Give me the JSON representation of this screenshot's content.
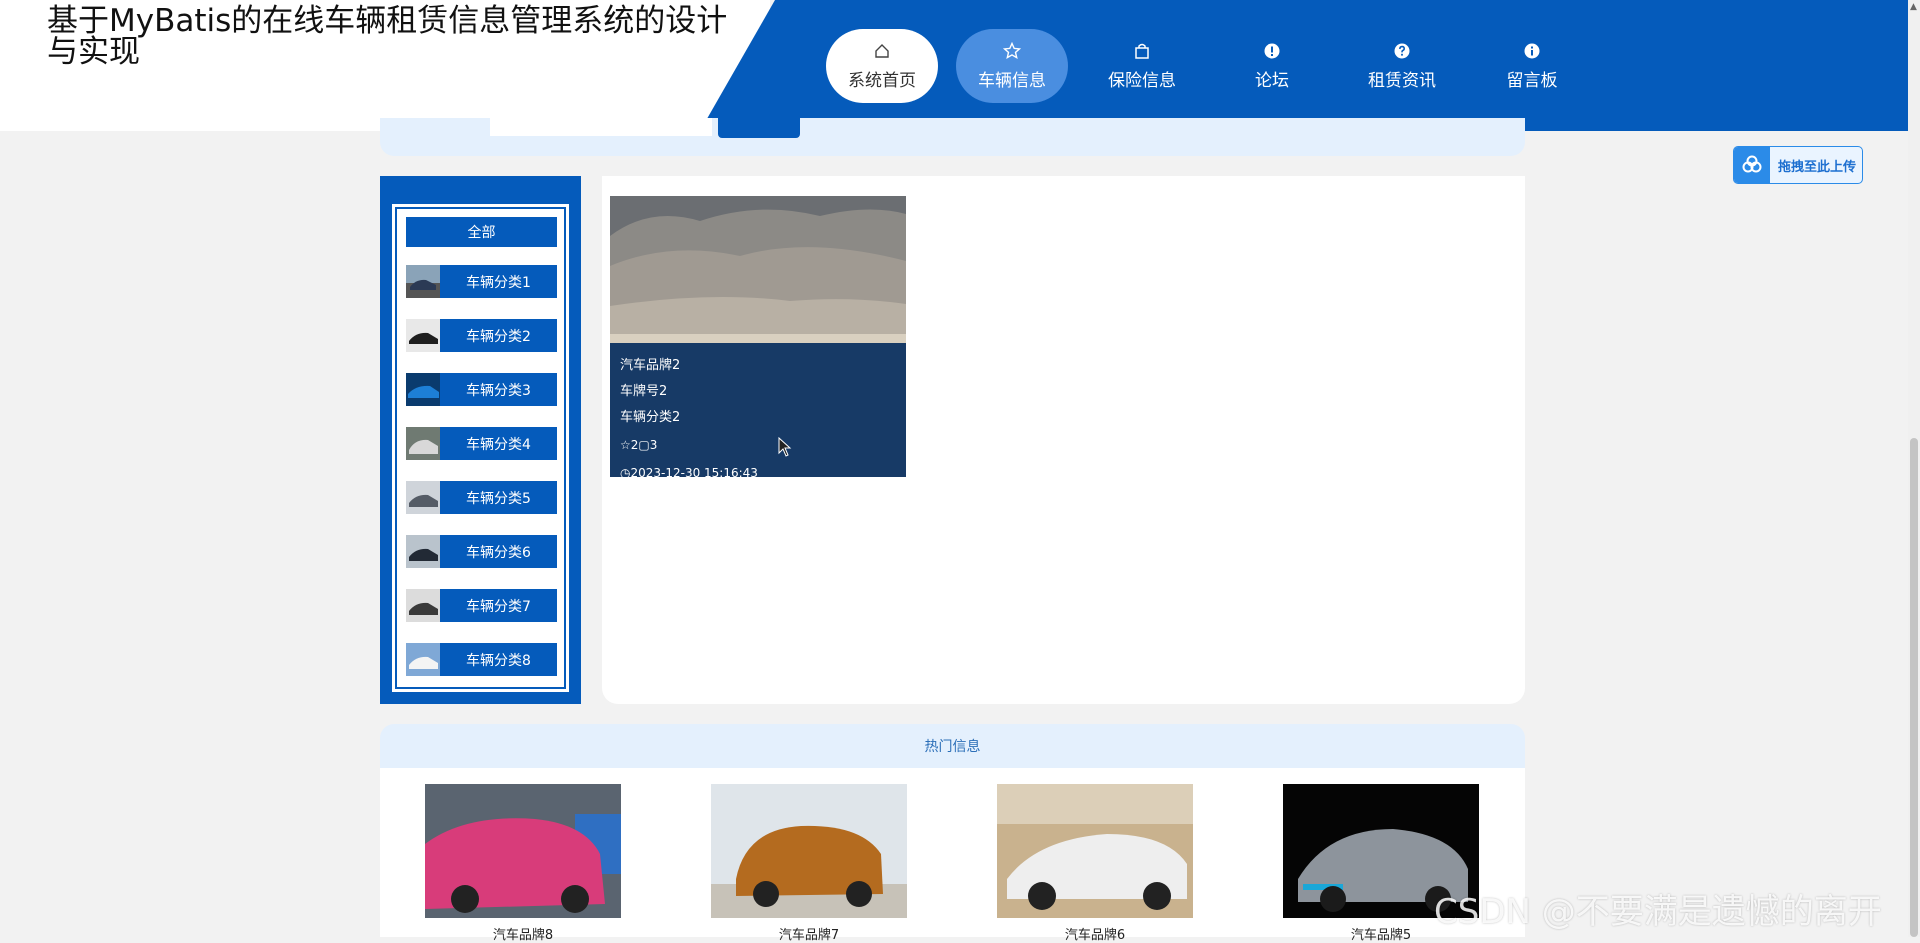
{
  "header": {
    "title": "基于MyBatis的在线车辆租赁信息管理系统的设计与实现",
    "nav": [
      {
        "label": "系统首页",
        "icon": "home-icon"
      },
      {
        "label": "车辆信息",
        "icon": "star-icon"
      },
      {
        "label": "保险信息",
        "icon": "bag-icon"
      },
      {
        "label": "论坛",
        "icon": "exclamation-icon"
      },
      {
        "label": "租赁资讯",
        "icon": "question-icon"
      },
      {
        "label": "留言板",
        "icon": "info-icon"
      }
    ],
    "active_nav": "车辆信息"
  },
  "upload_widget": {
    "label": "拖拽至此上传",
    "icon": "upload-cloud-icon"
  },
  "sidebar": {
    "all_label": "全部",
    "categories": [
      {
        "label": "车辆分类1"
      },
      {
        "label": "车辆分类2"
      },
      {
        "label": "车辆分类3"
      },
      {
        "label": "车辆分类4"
      },
      {
        "label": "车辆分类5"
      },
      {
        "label": "车辆分类6"
      },
      {
        "label": "车辆分类7"
      },
      {
        "label": "车辆分类8"
      }
    ]
  },
  "listing": {
    "cards": [
      {
        "brand": "汽车品牌2",
        "plate": "车牌号2",
        "category": "车辆分类2",
        "likes": "2",
        "views": "3",
        "time": "2023-12-30 15:16:43"
      }
    ]
  },
  "hot": {
    "title": "热门信息",
    "items": [
      {
        "label": "汽车品牌8"
      },
      {
        "label": "汽车品牌7"
      },
      {
        "label": "汽车品牌6"
      },
      {
        "label": "汽车品牌5"
      }
    ]
  },
  "watermark": "CSDN @不要满是遗憾的离开",
  "colors": {
    "primary": "#055bbb",
    "light_band": "#e4f0fd",
    "card_overlay": "#173a66"
  }
}
